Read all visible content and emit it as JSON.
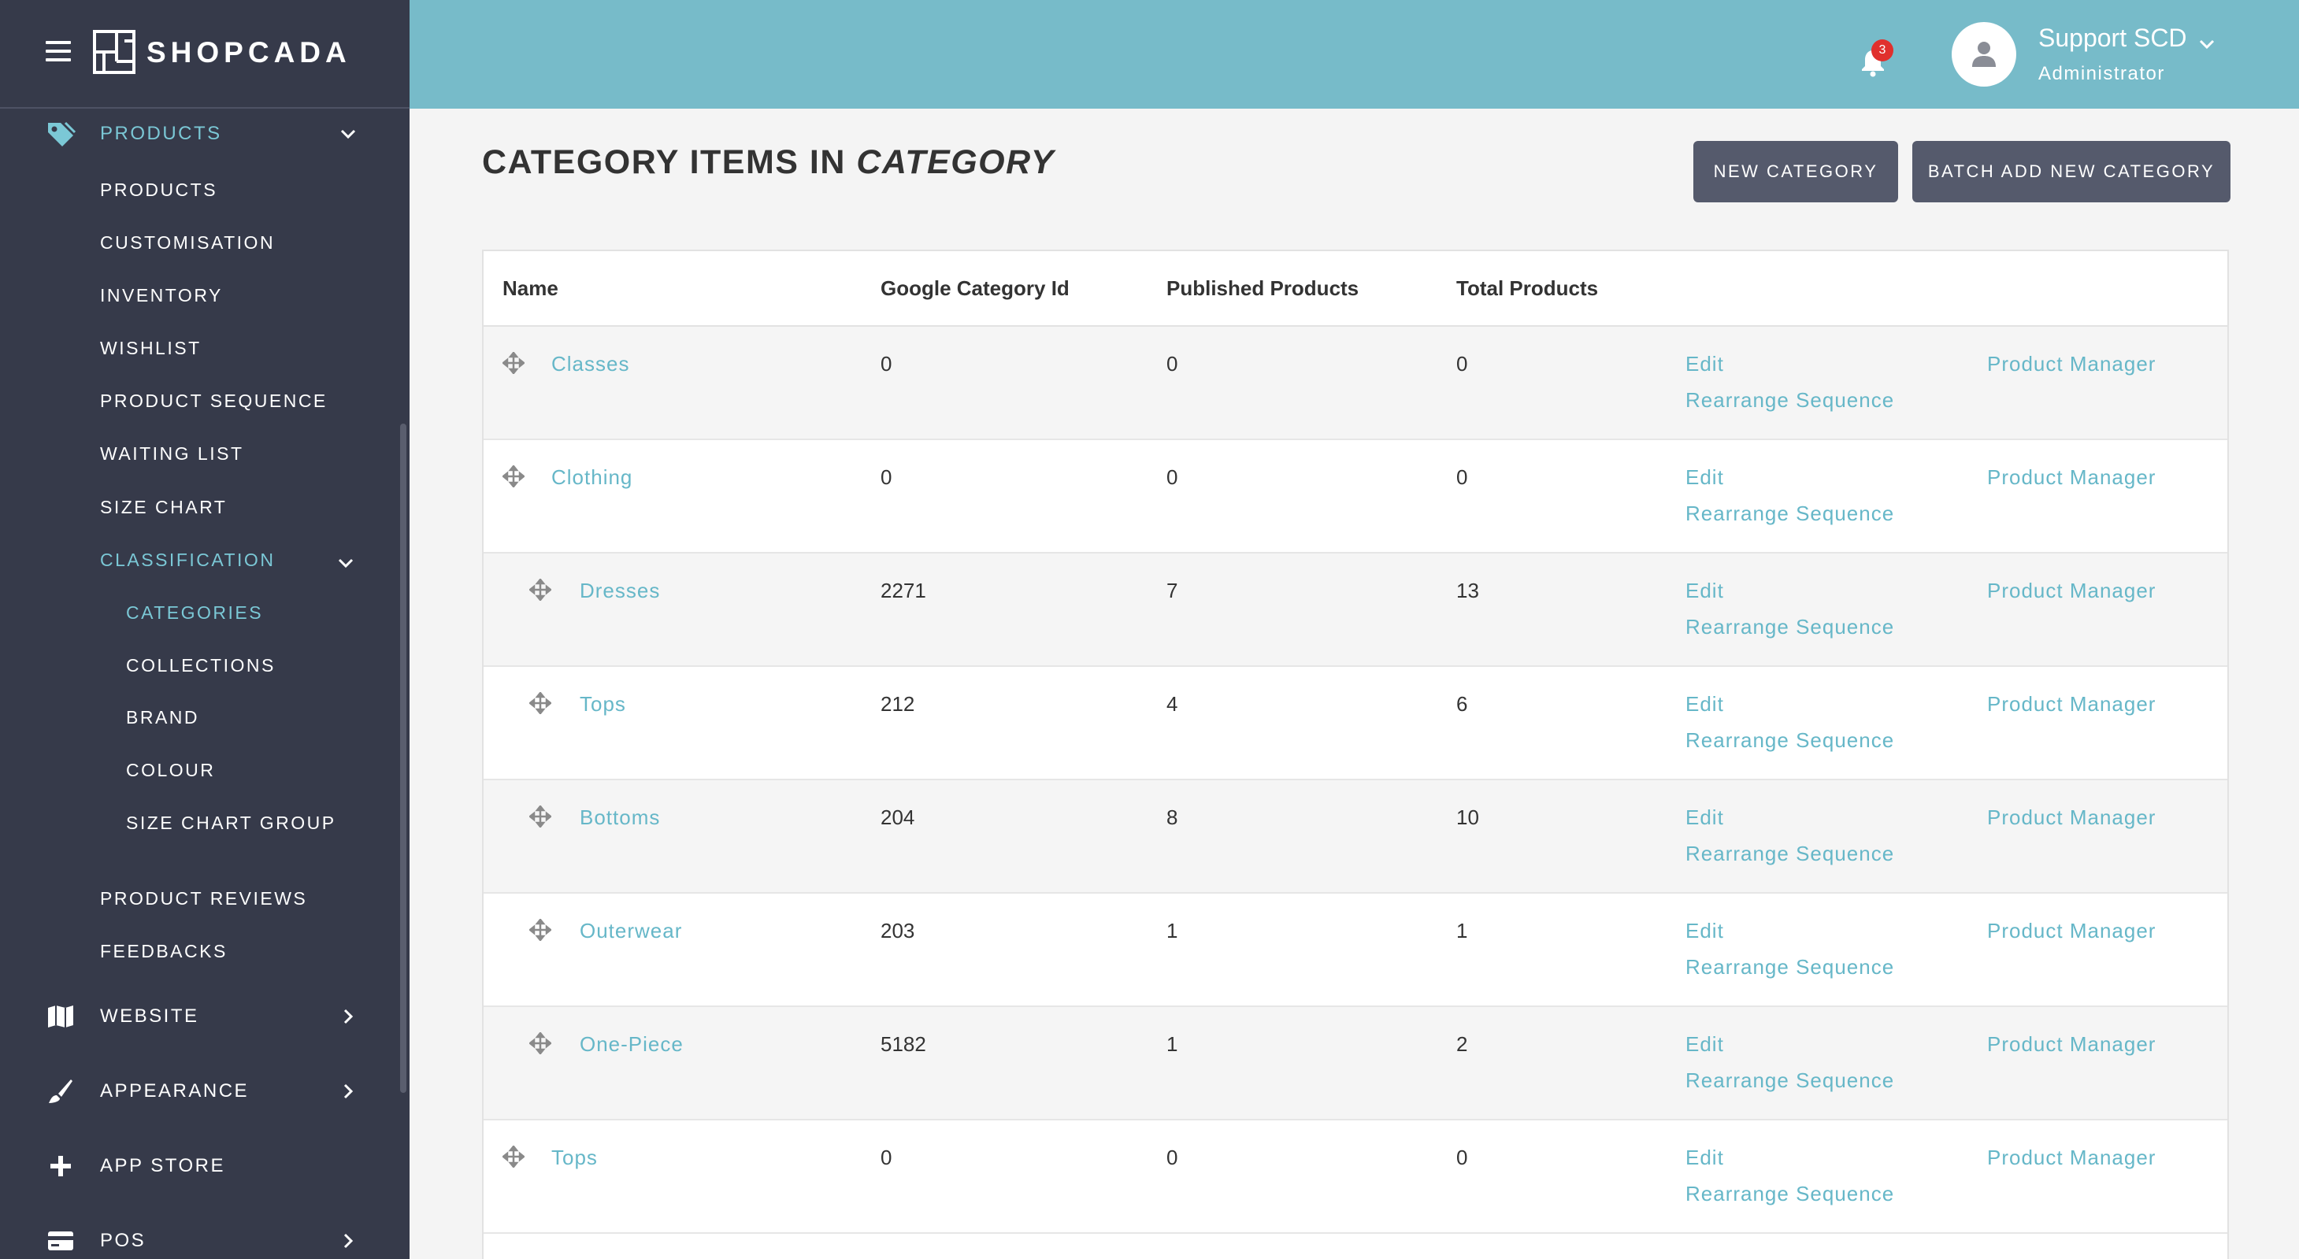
{
  "brand": {
    "name": "SHOPCADA"
  },
  "sidebar": {
    "products_section": {
      "label": "PRODUCTS"
    },
    "products_items": [
      {
        "label": "PRODUCTS"
      },
      {
        "label": "CUSTOMISATION"
      },
      {
        "label": "INVENTORY"
      },
      {
        "label": "WISHLIST"
      },
      {
        "label": "PRODUCT SEQUENCE"
      },
      {
        "label": "WAITING LIST"
      },
      {
        "label": "SIZE CHART"
      }
    ],
    "classification": {
      "label": "CLASSIFICATION"
    },
    "classification_items": [
      {
        "label": "CATEGORIES"
      },
      {
        "label": "COLLECTIONS"
      },
      {
        "label": "BRAND"
      },
      {
        "label": "COLOUR"
      },
      {
        "label": "SIZE CHART GROUP"
      }
    ],
    "more_items": [
      {
        "label": "PRODUCT REVIEWS"
      },
      {
        "label": "FEEDBACKS"
      }
    ],
    "sections": [
      {
        "label": "WEBSITE",
        "icon": "map-icon"
      },
      {
        "label": "APPEARANCE",
        "icon": "brush-icon"
      },
      {
        "label": "APP STORE",
        "icon": "plus-icon"
      },
      {
        "label": "POS",
        "icon": "card-icon"
      }
    ]
  },
  "header": {
    "notification_count": "3",
    "user_name": "Support SCD",
    "user_role": "Administrator"
  },
  "main": {
    "title_prefix": "CATEGORY ITEMS IN ",
    "title_em": "CATEGORY",
    "new_category_label": "NEW CATEGORY",
    "batch_add_label": "BATCH ADD NEW CATEGORY",
    "columns": [
      "Name",
      "Google Category Id",
      "Published Products",
      "Total Products"
    ],
    "rows": [
      {
        "name": "Classes",
        "google_id": "0",
        "published": "0",
        "total": "0",
        "indent": 0,
        "edit": "Edit",
        "rearrange": "Rearrange Sequence",
        "manager": "Product Manager"
      },
      {
        "name": "Clothing",
        "google_id": "0",
        "published": "0",
        "total": "0",
        "indent": 0,
        "edit": "Edit",
        "rearrange": "Rearrange Sequence",
        "manager": "Product Manager"
      },
      {
        "name": "Dresses",
        "google_id": "2271",
        "published": "7",
        "total": "13",
        "indent": 1,
        "edit": "Edit",
        "rearrange": "Rearrange Sequence",
        "manager": "Product Manager"
      },
      {
        "name": "Tops",
        "google_id": "212",
        "published": "4",
        "total": "6",
        "indent": 1,
        "edit": "Edit",
        "rearrange": "Rearrange Sequence",
        "manager": "Product Manager"
      },
      {
        "name": "Bottoms",
        "google_id": "204",
        "published": "8",
        "total": "10",
        "indent": 1,
        "edit": "Edit",
        "rearrange": "Rearrange Sequence",
        "manager": "Product Manager"
      },
      {
        "name": "Outerwear",
        "google_id": "203",
        "published": "1",
        "total": "1",
        "indent": 1,
        "edit": "Edit",
        "rearrange": "Rearrange Sequence",
        "manager": "Product Manager"
      },
      {
        "name": "One-Piece",
        "google_id": "5182",
        "published": "1",
        "total": "2",
        "indent": 1,
        "edit": "Edit",
        "rearrange": "Rearrange Sequence",
        "manager": "Product Manager"
      },
      {
        "name": "Tops",
        "google_id": "0",
        "published": "0",
        "total": "0",
        "indent": 0,
        "edit": "Edit",
        "rearrange": "Rearrange Sequence",
        "manager": "Product Manager"
      }
    ]
  },
  "colors": {
    "sidebar_bg": "#363a4a",
    "header_bg": "#77bbc9",
    "accent": "#7bc8d6",
    "link": "#66b7c8",
    "button_bg": "#555a6c",
    "badge": "#e0302d"
  }
}
